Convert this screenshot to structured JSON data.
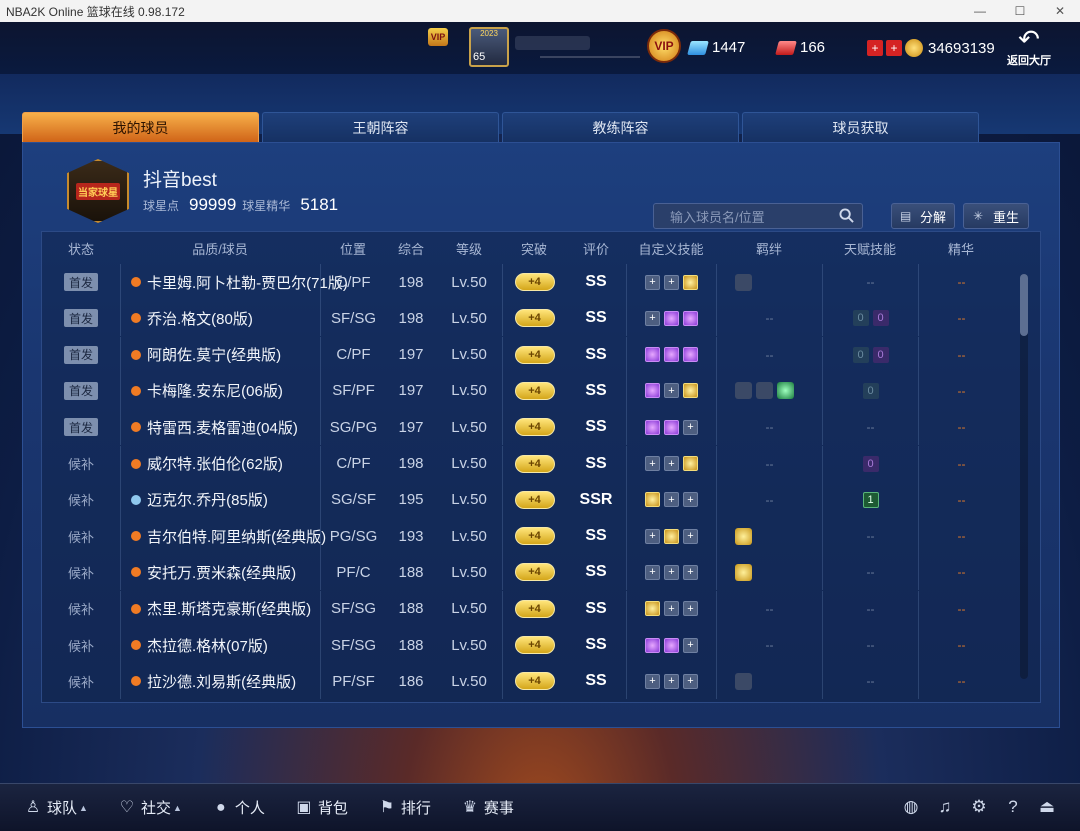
{
  "window": {
    "title": "NBA2K Online 篮球在线 0.98.172"
  },
  "topbar": {
    "vip_small": "VIP",
    "card_year": "2023",
    "card_level": "65",
    "vip_label": "VIP",
    "diamonds": "1447",
    "tickets": "166",
    "coins": "34693139",
    "back_label": "返回大厅"
  },
  "tabs": [
    {
      "label": "我的球员"
    },
    {
      "label": "王朝阵容"
    },
    {
      "label": "教练阵容"
    },
    {
      "label": "球员获取"
    }
  ],
  "profile": {
    "logo_text": "当家球星",
    "name": "抖音best",
    "points_label": "球星点",
    "points": "99999",
    "essence_label": "球星精华",
    "essence": "5181"
  },
  "search": {
    "placeholder": "输入球员名/位置"
  },
  "buttons": {
    "decompose": "分解",
    "rebirth": "重生"
  },
  "columns": {
    "status": "状态",
    "player": "品质/球员",
    "position": "位置",
    "overall": "综合",
    "level": "等级",
    "breakthrough": "突破",
    "rating": "评价",
    "skills": "自定义技能",
    "bond": "羁绊",
    "talent": "天赋技能",
    "essence": "精华"
  },
  "rows": [
    {
      "status": "首发",
      "starter": true,
      "quality": "orange",
      "name": "卡里姆.阿卜杜勒-贾巴尔(71版)",
      "pos": "C/PF",
      "ovr": "198",
      "lvl": "Lv.50",
      "brk": "+4",
      "grade": "SS",
      "skills": [
        "empty",
        "empty",
        "gold"
      ],
      "bond": "icon",
      "talent": "--",
      "ess": "--"
    },
    {
      "status": "首发",
      "starter": true,
      "quality": "orange",
      "name": "乔治.格文(80版)",
      "pos": "SF/SG",
      "ovr": "198",
      "lvl": "Lv.50",
      "brk": "+4",
      "grade": "SS",
      "skills": [
        "empty",
        "purple",
        "purple"
      ],
      "bond": "--",
      "talent": [
        "0",
        "0"
      ],
      "ess": "--"
    },
    {
      "status": "首发",
      "starter": true,
      "quality": "orange",
      "name": "阿朗佐.莫宁(经典版)",
      "pos": "C/PF",
      "ovr": "197",
      "lvl": "Lv.50",
      "brk": "+4",
      "grade": "SS",
      "skills": [
        "purple",
        "purple",
        "purple"
      ],
      "bond": "--",
      "talent": [
        "0",
        "0"
      ],
      "ess": "--"
    },
    {
      "status": "首发",
      "starter": true,
      "quality": "orange",
      "name": "卡梅隆.安东尼(06版)",
      "pos": "SF/PF",
      "ovr": "197",
      "lvl": "Lv.50",
      "brk": "+4",
      "grade": "SS",
      "skills": [
        "purple",
        "empty",
        "gold"
      ],
      "bond": "three",
      "talent": [
        "0"
      ],
      "ess": "--"
    },
    {
      "status": "首发",
      "starter": true,
      "quality": "orange",
      "name": "特雷西.麦格雷迪(04版)",
      "pos": "SG/PG",
      "ovr": "197",
      "lvl": "Lv.50",
      "brk": "+4",
      "grade": "SS",
      "skills": [
        "purple",
        "purple",
        "empty"
      ],
      "bond": "--",
      "talent": "--",
      "ess": "--"
    },
    {
      "status": "候补",
      "starter": false,
      "quality": "orange",
      "name": "威尔特.张伯伦(62版)",
      "pos": "C/PF",
      "ovr": "198",
      "lvl": "Lv.50",
      "brk": "+4",
      "grade": "SS",
      "skills": [
        "empty",
        "empty",
        "gold"
      ],
      "bond": "--",
      "talent": [
        "0"
      ],
      "ess": "--"
    },
    {
      "status": "候补",
      "starter": false,
      "quality": "blue",
      "name": "迈克尔.乔丹(85版)",
      "pos": "SG/SF",
      "ovr": "195",
      "lvl": "Lv.50",
      "brk": "+4",
      "grade": "SSR",
      "skills": [
        "gold",
        "empty",
        "empty"
      ],
      "bond": "--",
      "talent": [
        "1"
      ],
      "ess": "--"
    },
    {
      "status": "候补",
      "starter": false,
      "quality": "orange",
      "name": "吉尔伯特.阿里纳斯(经典版)",
      "pos": "PG/SG",
      "ovr": "193",
      "lvl": "Lv.50",
      "brk": "+4",
      "grade": "SS",
      "skills": [
        "empty",
        "gold",
        "empty"
      ],
      "bond": "gold",
      "talent": "--",
      "ess": "--"
    },
    {
      "status": "候补",
      "starter": false,
      "quality": "orange",
      "name": "安托万.贾米森(经典版)",
      "pos": "PF/C",
      "ovr": "188",
      "lvl": "Lv.50",
      "brk": "+4",
      "grade": "SS",
      "skills": [
        "empty",
        "empty",
        "empty"
      ],
      "bond": "gold",
      "talent": "--",
      "ess": "--"
    },
    {
      "status": "候补",
      "starter": false,
      "quality": "orange",
      "name": "杰里.斯塔克豪斯(经典版)",
      "pos": "SF/SG",
      "ovr": "188",
      "lvl": "Lv.50",
      "brk": "+4",
      "grade": "SS",
      "skills": [
        "gold",
        "empty",
        "empty"
      ],
      "bond": "--",
      "talent": "--",
      "ess": "--"
    },
    {
      "status": "候补",
      "starter": false,
      "quality": "orange",
      "name": "杰拉德.格林(07版)",
      "pos": "SF/SG",
      "ovr": "188",
      "lvl": "Lv.50",
      "brk": "+4",
      "grade": "SS",
      "skills": [
        "purple",
        "purple",
        "empty"
      ],
      "bond": "--",
      "talent": "--",
      "ess": "--"
    },
    {
      "status": "候补",
      "starter": false,
      "quality": "orange",
      "name": "拉沙德.刘易斯(经典版)",
      "pos": "PF/SF",
      "ovr": "186",
      "lvl": "Lv.50",
      "brk": "+4",
      "grade": "SS",
      "skills": [
        "empty",
        "empty",
        "empty"
      ],
      "bond": "grey",
      "talent": "--",
      "ess": "--"
    }
  ],
  "bottom": {
    "nav": [
      {
        "icon": "person-icon",
        "label": "球队",
        "caret": true
      },
      {
        "icon": "heart-icon",
        "label": "社交",
        "caret": true
      },
      {
        "icon": "user-icon",
        "label": "个人"
      },
      {
        "icon": "bag-icon",
        "label": "背包"
      },
      {
        "icon": "rank-icon",
        "label": "排行"
      },
      {
        "icon": "trophy-icon",
        "label": "赛事"
      }
    ],
    "right": [
      "headset-icon",
      "music-icon",
      "gear-icon",
      "help-icon",
      "exit-icon"
    ]
  },
  "colors": {
    "tab_active": "#e88a2e",
    "orange_quality": "#f07b24",
    "blue_quality": "#8fc8ee"
  }
}
